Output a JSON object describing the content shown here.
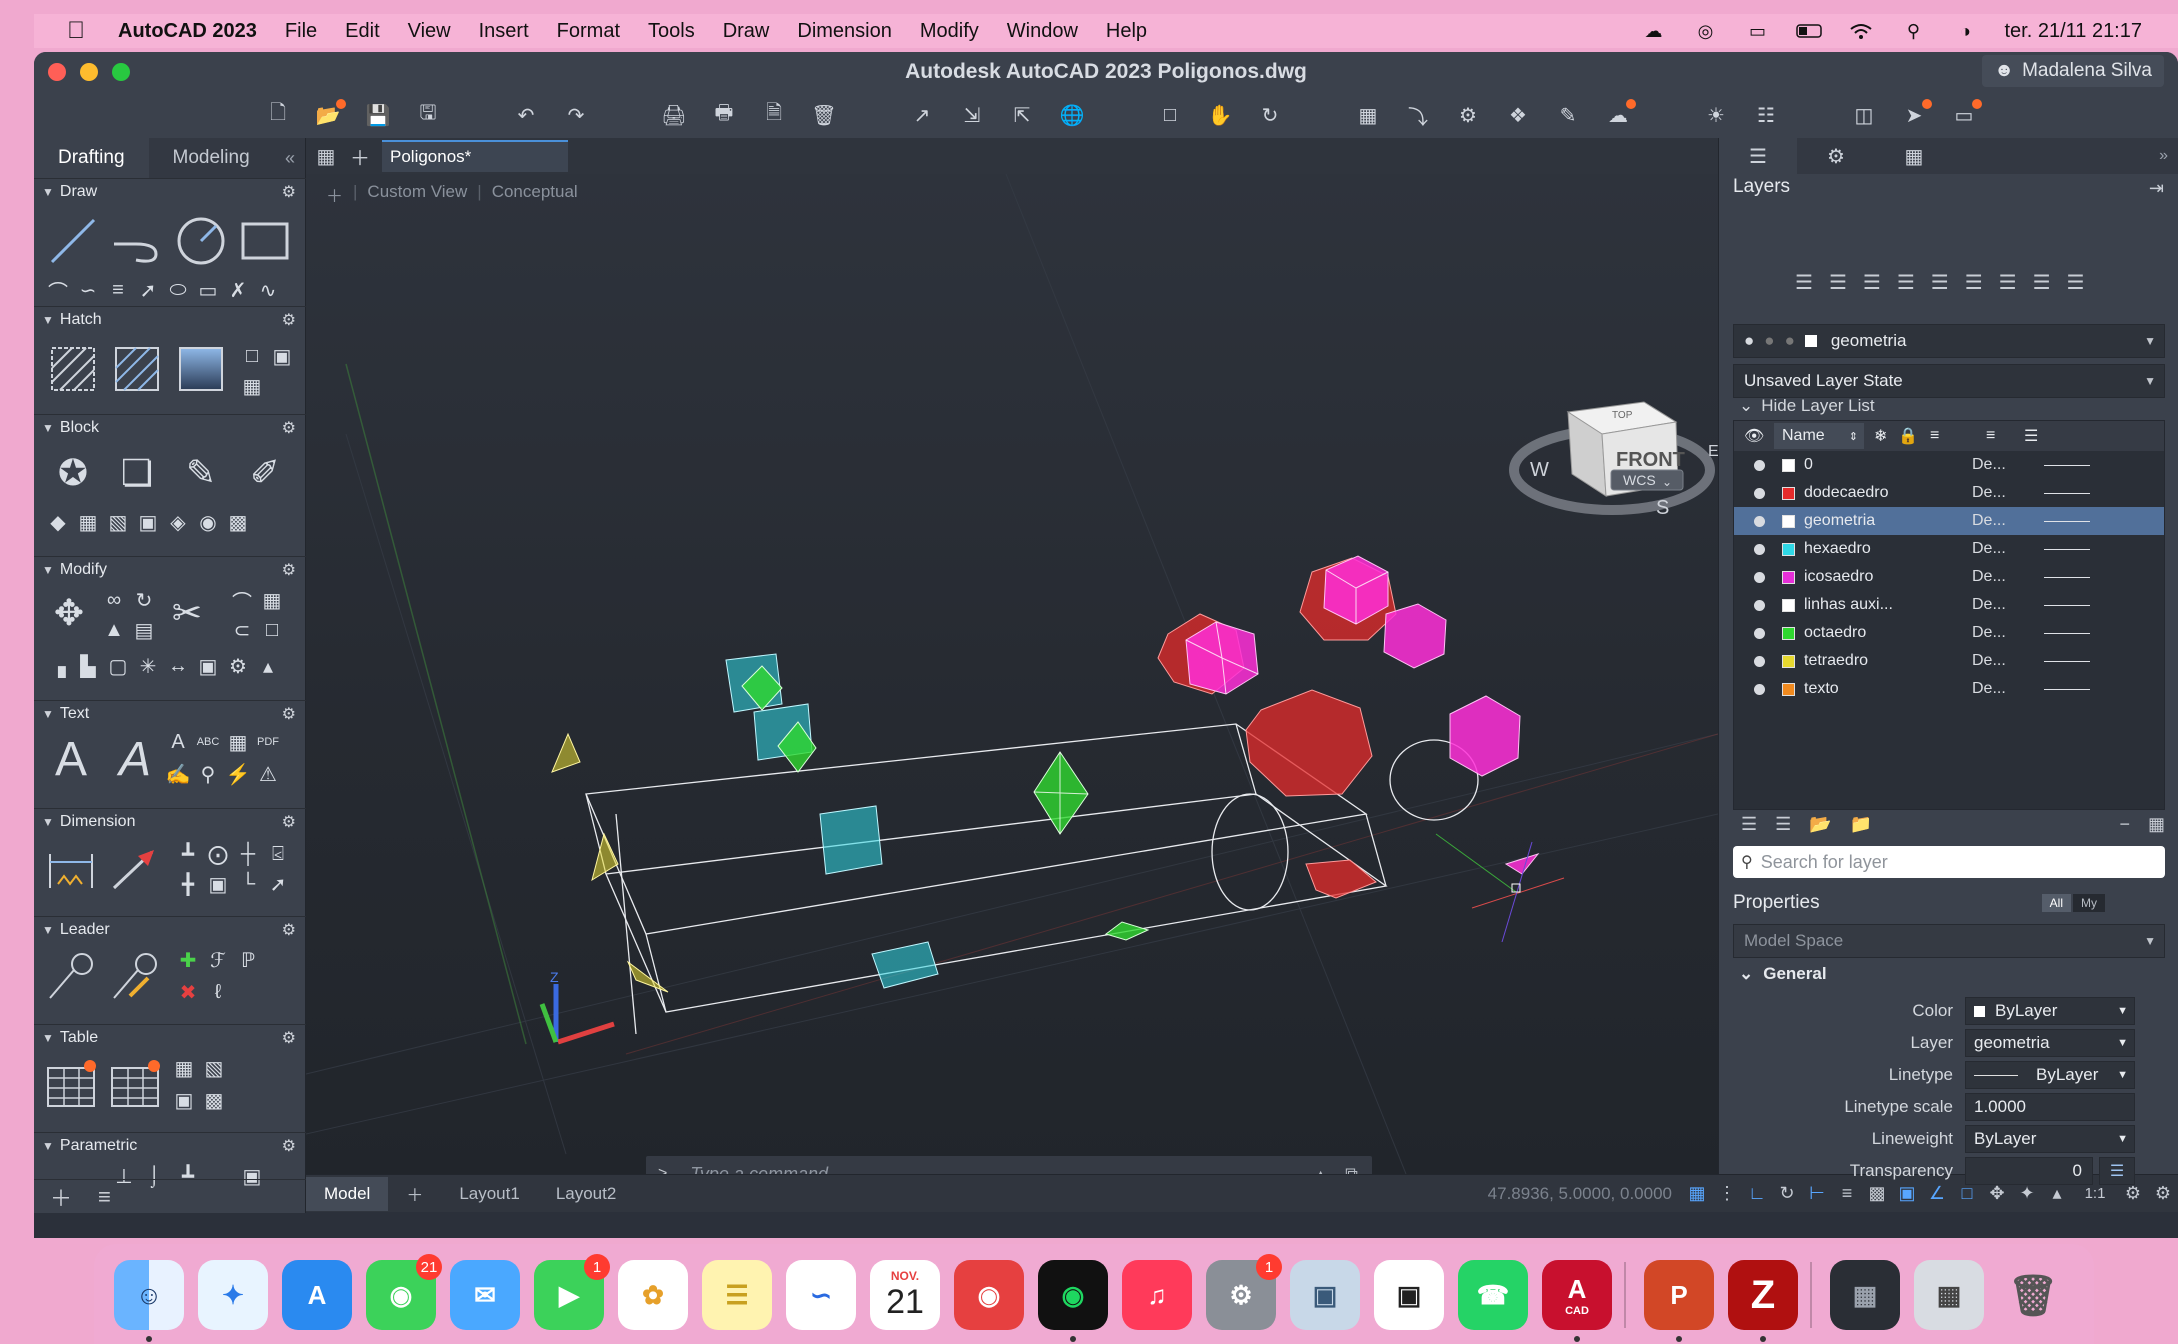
{
  "menubar": {
    "app_name": "AutoCAD 2023",
    "items": [
      "File",
      "Edit",
      "View",
      "Insert",
      "Format",
      "Tools",
      "Draw",
      "Dimension",
      "Modify",
      "Window",
      "Help"
    ],
    "datetime": "ter. 21/11  21:17"
  },
  "window": {
    "title": "Autodesk AutoCAD 2023   Poligonos.dwg",
    "user": "Madalena Silva"
  },
  "palette": {
    "tabs": [
      "Drafting",
      "Modeling"
    ],
    "sections": [
      "Draw",
      "Hatch",
      "Block",
      "Modify",
      "Text",
      "Dimension",
      "Leader",
      "Table",
      "Parametric"
    ]
  },
  "doc_tab": "Poligonos*",
  "viewport": {
    "view_label": "Custom View",
    "style_label": "Conceptual",
    "viewcube_face": "FRONT",
    "viewcube_top": "TOP",
    "compass": [
      "W",
      "S",
      "E"
    ],
    "wcs": "WCS"
  },
  "command": {
    "prompt": ">_",
    "placeholder": "Type a command"
  },
  "status": {
    "tabs": [
      "Model",
      "Layout1",
      "Layout2"
    ],
    "coords": "47.8936, 5.0000, 0.0000",
    "scale": "1:1"
  },
  "layers_panel": {
    "title": "Layers",
    "current_layer": "geometria",
    "layer_state": "Unsaved Layer State",
    "hide_list": "Hide Layer List",
    "name_header": "Name",
    "rows": [
      {
        "name": "0",
        "color": "#ffffff",
        "linetype": "De..."
      },
      {
        "name": "dodecaedro",
        "color": "#e52b2b",
        "linetype": "De..."
      },
      {
        "name": "geometria",
        "color": "#ffffff",
        "linetype": "De...",
        "selected": true
      },
      {
        "name": "hexaedro",
        "color": "#2fd8e6",
        "linetype": "De..."
      },
      {
        "name": "icosaedro",
        "color": "#e62fd8",
        "linetype": "De..."
      },
      {
        "name": "linhas auxi...",
        "color": "#ffffff",
        "linetype": "De..."
      },
      {
        "name": "octaedro",
        "color": "#2fd82f",
        "linetype": "De..."
      },
      {
        "name": "tetraedro",
        "color": "#e6d82f",
        "linetype": "De..."
      },
      {
        "name": "texto",
        "color": "#f08a1f",
        "linetype": "De..."
      }
    ],
    "search_placeholder": "Search for layer"
  },
  "properties_panel": {
    "title": "Properties",
    "toggle_all": "All",
    "toggle_my": "My",
    "space": "Model Space",
    "group": "General",
    "fields": [
      {
        "label": "Color",
        "value": "ByLayer"
      },
      {
        "label": "Layer",
        "value": "geometria"
      },
      {
        "label": "Linetype",
        "value": "ByLayer"
      },
      {
        "label": "Linetype scale",
        "value": "1.0000"
      },
      {
        "label": "Lineweight",
        "value": "ByLayer"
      },
      {
        "label": "Transparency",
        "value": "0"
      }
    ]
  },
  "dock": {
    "badges": {
      "messages": "21",
      "facetime": "1",
      "settings": "1"
    },
    "calendar_month": "NOV.",
    "calendar_day": "21",
    "autocad_label": "CAD"
  }
}
